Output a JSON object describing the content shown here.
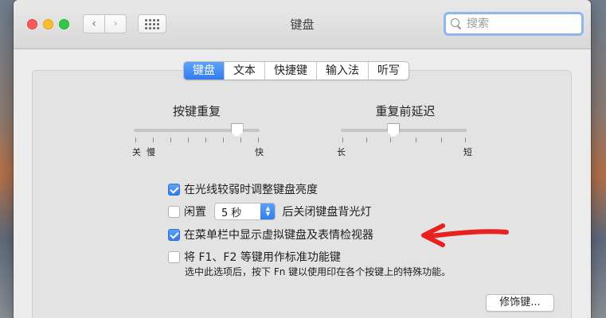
{
  "window": {
    "title": "键盘"
  },
  "nav": {
    "back_icon": "chevron-left-icon",
    "forward_icon": "chevron-right-icon",
    "grid_icon": "grid-icon"
  },
  "search": {
    "placeholder": "搜索"
  },
  "tabs": [
    {
      "label": "键盘",
      "active": true
    },
    {
      "label": "文本",
      "active": false
    },
    {
      "label": "快捷键",
      "active": false
    },
    {
      "label": "输入法",
      "active": false
    },
    {
      "label": "听写",
      "active": false
    }
  ],
  "key_repeat": {
    "title": "按键重复",
    "min_label": "关",
    "slow_label": "慢",
    "max_label": "快",
    "level": 0.82
  },
  "delay_until_repeat": {
    "title": "重复前延迟",
    "min_label": "长",
    "max_label": "短",
    "level": 0.42
  },
  "options": {
    "adjust_brightness": {
      "label": "在光线较弱时调整键盘亮度",
      "checked": true
    },
    "idle": {
      "label_before": "闲置",
      "popup_value": "5 秒",
      "label_after": "后关闭键盘背光灯",
      "checked": false
    },
    "show_viewer": {
      "label": "在菜单栏中显示虚拟键盘及表情检视器",
      "checked": true
    },
    "fn_keys": {
      "label": "将 F1、F2 等键用作标准功能键",
      "checked": false,
      "note": "选中此选项后，按下 Fn 键以使用印在各个按键上的特殊功能。"
    }
  },
  "modifier_button": {
    "label": "修饰键..."
  },
  "colors": {
    "accent": "#2f7cf0",
    "annotation": "#e8201f"
  }
}
